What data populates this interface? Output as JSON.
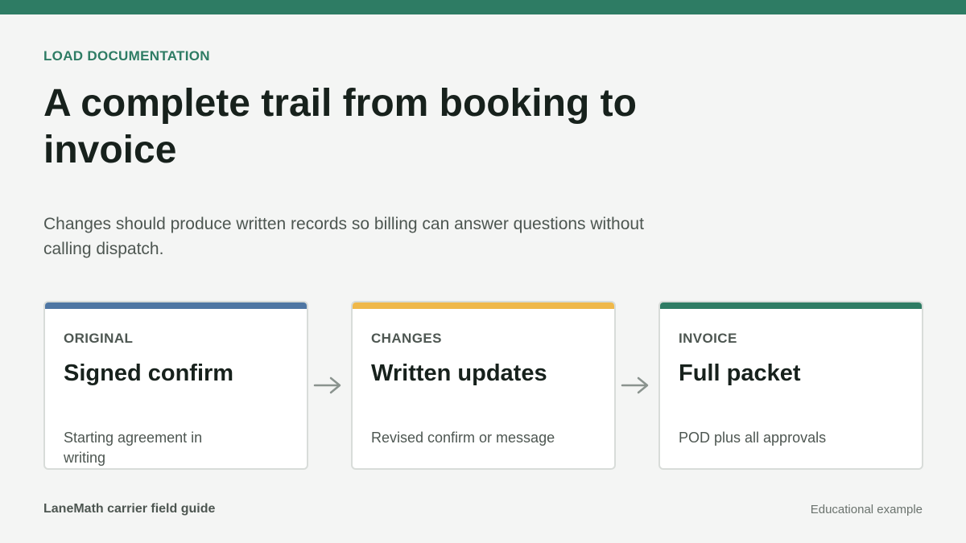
{
  "header": {
    "eyebrow": "LOAD DOCUMENTATION",
    "headline": "A complete trail from booking to invoice",
    "subtitle": "Changes should produce written records so billing can answer questions without calling dispatch."
  },
  "steps": [
    {
      "tag": "ORIGINAL",
      "title": "Signed confirm",
      "description": "Starting agreement in writing",
      "accent": "#4e76a3"
    },
    {
      "tag": "CHANGES",
      "title": "Written updates",
      "description": "Revised confirm or message",
      "accent": "#efb84a"
    },
    {
      "tag": "INVOICE",
      "title": "Full packet",
      "description": "POD plus all approvals",
      "accent": "#2e7c64"
    }
  ],
  "footer": {
    "source": "LaneMath carrier field guide",
    "note": "Educational example"
  },
  "colors": {
    "brand": "#2e7c64",
    "arrow": "#8a938e"
  },
  "icons": {
    "connector": "arrow-right-icon"
  }
}
